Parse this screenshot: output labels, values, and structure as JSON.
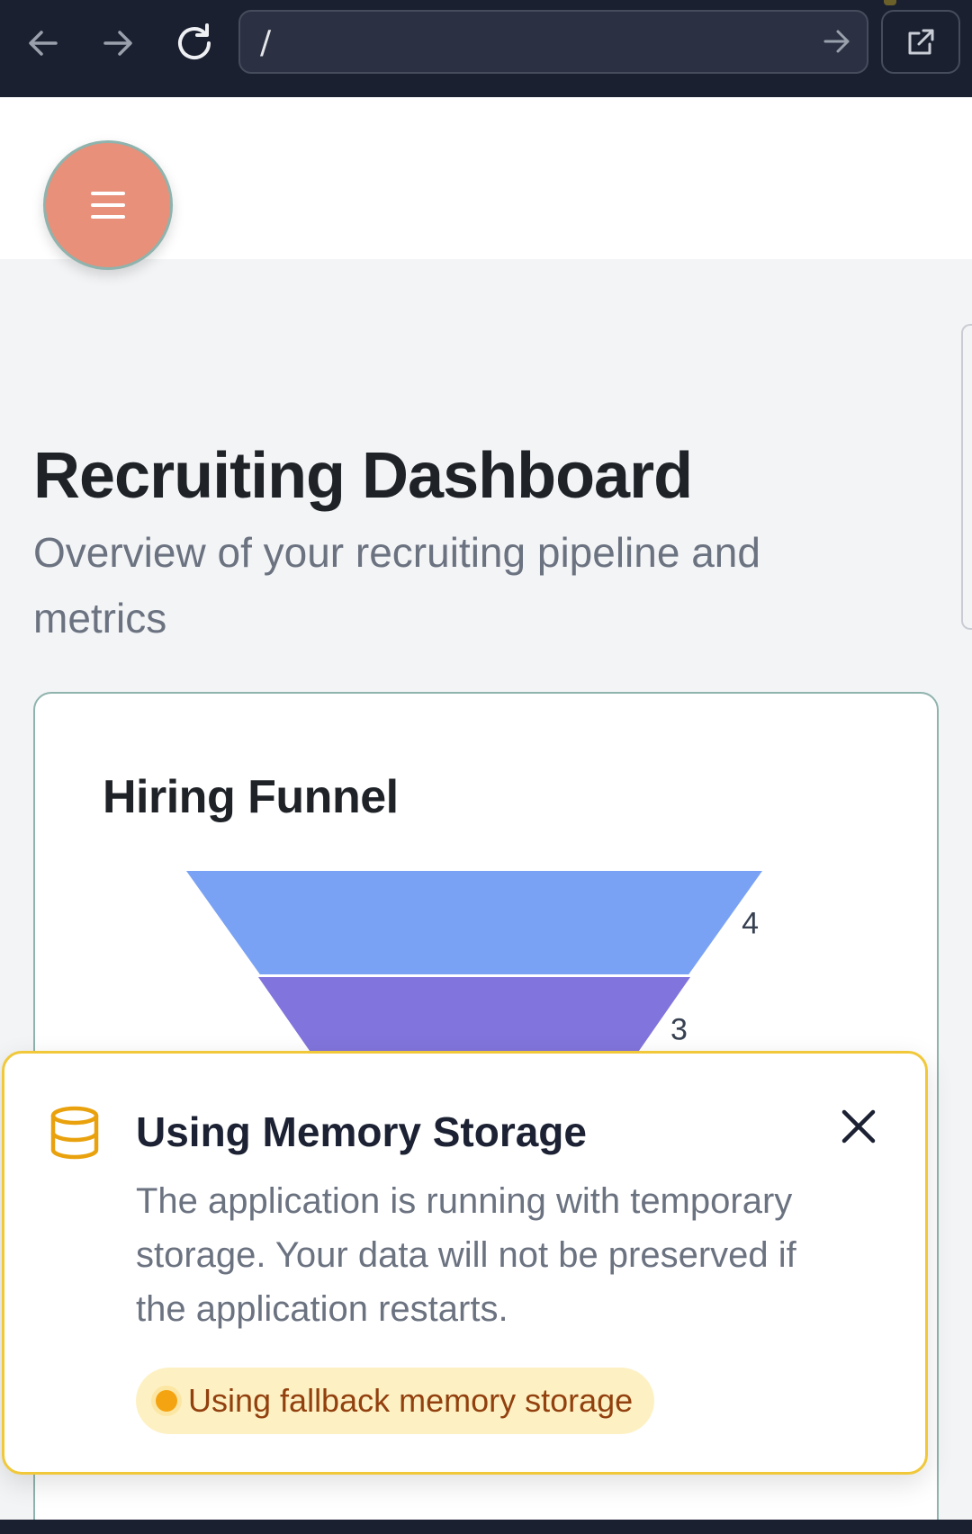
{
  "browser": {
    "url": "/",
    "icons": [
      "back-arrow-icon",
      "forward-arrow-icon",
      "reload-icon",
      "go-arrow-icon",
      "external-link-icon"
    ]
  },
  "header": {
    "menu_icon": "hamburger-icon",
    "menu_color": "#e8907a"
  },
  "page": {
    "title": "Recruiting Dashboard",
    "subtitle": "Overview of your recruiting pipeline and metrics"
  },
  "funnel_card": {
    "title": "Hiring Funnel"
  },
  "chart_data": {
    "type": "funnel",
    "title": "Hiring Funnel",
    "stages": [
      {
        "value": 4,
        "color": "#7aa2f4"
      },
      {
        "value": 3,
        "color": "#8174dc"
      }
    ]
  },
  "notice": {
    "icon": "database-icon",
    "title": "Using Memory Storage",
    "body": "The application is running with temporary storage. Your data will not be preserved if the application restarts.",
    "badge": "Using fallback memory storage",
    "accent": "#f0c83a"
  }
}
